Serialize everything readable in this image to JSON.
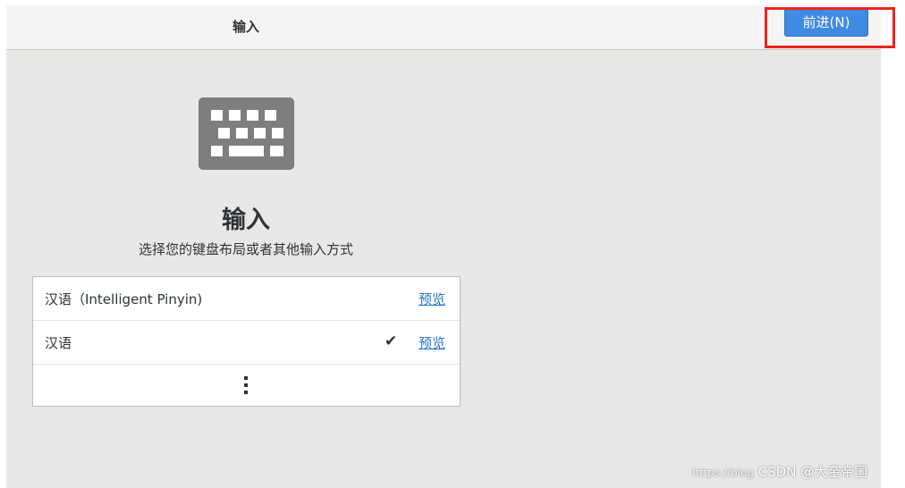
{
  "header": {
    "title": "输入",
    "next_label": "前进(N)"
  },
  "page": {
    "icon": "keyboard-icon",
    "heading": "输入",
    "subtitle": "选择您的键盘布局或者其他输入方式"
  },
  "input_list": {
    "items": [
      {
        "label": "汉语（Intelligent Pinyin)",
        "selected": false,
        "preview_label": "预览"
      },
      {
        "label": "汉语",
        "selected": true,
        "check_icon": "check-icon",
        "preview_label": "预览"
      }
    ],
    "more_icon": "vertical-ellipsis-icon"
  },
  "watermark": {
    "url_text": "https://blog",
    "text": "CSDN @大奎帝国"
  },
  "colors": {
    "accent": "#3f8ae2",
    "highlight": "#e8251e",
    "link": "#2a76c6",
    "background": "#e8e8e7"
  }
}
